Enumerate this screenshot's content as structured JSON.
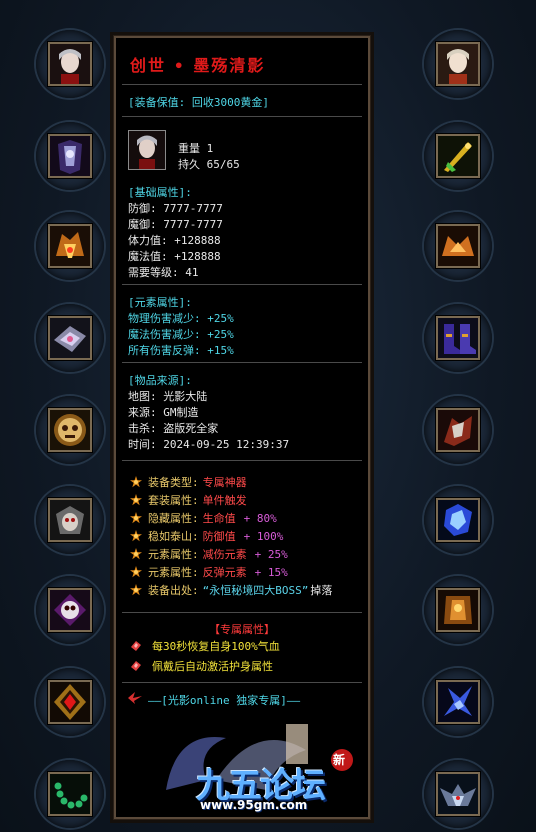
{
  "item": {
    "title": "创世 • 墨殇清影",
    "value_line": "[装备保值: 回收3000黄金]",
    "weight": "重量 1",
    "durability": "持久 65/65"
  },
  "base": {
    "header": "[基础属性]:",
    "lines": [
      "防御: 7777-7777",
      "魔御: 7777-7777",
      "体力值: +128888",
      "魔法值: +128888",
      "需要等级: 41"
    ]
  },
  "element": {
    "header": "[元素属性]:",
    "lines": [
      "物理伤害减少: +25%",
      "魔法伤害减少: +25%",
      "所有伤害反弹: +15%"
    ]
  },
  "source": {
    "header": "[物品来源]:",
    "lines": [
      "地图: 光影大陆",
      "来源: GM制造",
      "击杀: 盗版死全家",
      "时间: 2024-09-25 12:39:37"
    ]
  },
  "specials": [
    {
      "key": "装备类型:",
      "val": "专属神器",
      "extra": ""
    },
    {
      "key": "套装属性:",
      "val": "单件触发",
      "extra": ""
    },
    {
      "key": "隐藏属性:",
      "val": "生命值",
      "extra": "+ 80%"
    },
    {
      "key": "稳如泰山:",
      "val": "防御值",
      "extra": "+ 100%"
    },
    {
      "key": "元素属性:",
      "val": "减伤元素",
      "extra": "+ 25%"
    },
    {
      "key": "元素属性:",
      "val": "反弹元素",
      "extra": "+ 15%"
    },
    {
      "key": "装备出处:",
      "val": "“永恒秘境四大BOSS”",
      "extra": "掉落"
    }
  ],
  "exclusive": {
    "header": "【专属属性】",
    "lines": [
      "每30秒恢复自身100%气血",
      "佩戴后自动激活护身属性"
    ]
  },
  "brand": "——[光影online 独家专属]——",
  "watermark": {
    "logo_text": "九五论坛",
    "url": "www.95gm.com",
    "badge": "新"
  },
  "slots": {
    "left": [
      "portrait-icon",
      "armor-icon",
      "helmet-icon",
      "bracelet-icon",
      "skull-medal-icon",
      "demon-mask-icon",
      "skull-emblem-icon",
      "red-gem-amulet-icon",
      "jade-bead-necklace-icon"
    ],
    "right": [
      "portrait-icon",
      "sword-icon",
      "wing-crown-icon",
      "boots-icon",
      "weapon-fist-icon",
      "crystal-icon",
      "dragon-armor-icon",
      "phoenix-blade-icon",
      "winged-helm-icon"
    ]
  },
  "colors": {
    "title": "#e01a1a",
    "cyan": "#4fd6e6",
    "key": "#e8c86a",
    "value": "#ff4a4a",
    "extra": "#d85cd8",
    "bonus": "#f2e23a"
  }
}
